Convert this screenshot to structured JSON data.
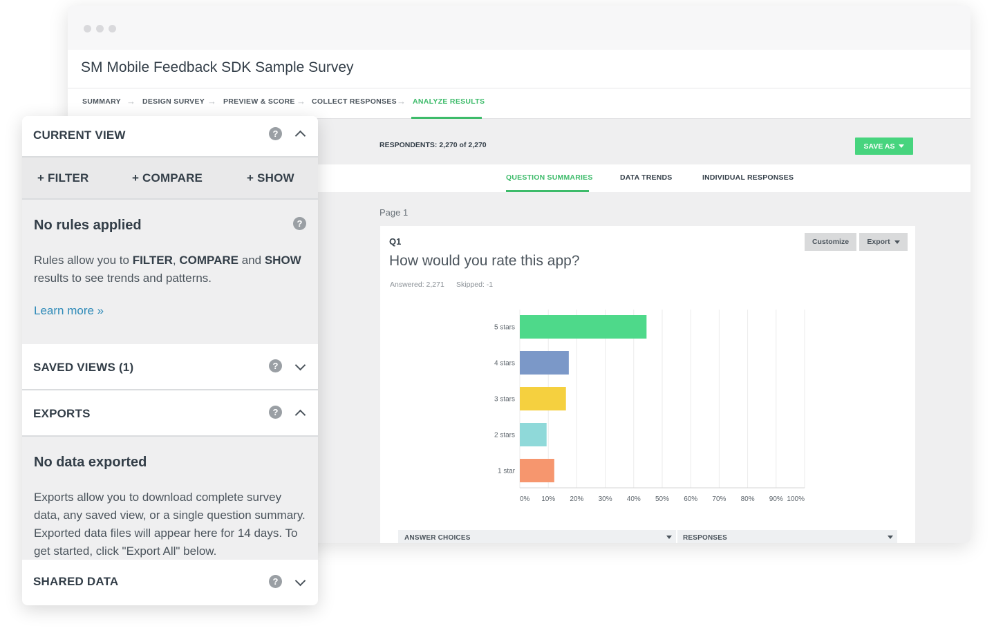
{
  "window": {
    "survey_title": "SM Mobile Feedback SDK Sample Survey",
    "steps": [
      "SUMMARY",
      "DESIGN SURVEY",
      "PREVIEW & SCORE",
      "COLLECT RESPONSES",
      "ANALYZE RESULTS"
    ],
    "active_step": "ANALYZE RESULTS",
    "respondents": "RESPONDENTS: 2,270 of 2,270",
    "save_as": "SAVE AS",
    "tabs": [
      "QUESTION SUMMARIES",
      "DATA TRENDS",
      "INDIVIDUAL RESPONSES"
    ],
    "active_tab": "QUESTION SUMMARIES",
    "page_label": "Page 1"
  },
  "question": {
    "number": "Q1",
    "title": "How would you rate this app?",
    "answered": "Answered: 2,271",
    "skipped": "Skipped: -1",
    "customize_label": "Customize",
    "export_label": "Export",
    "table_headers": [
      "ANSWER CHOICES",
      "RESPONSES"
    ]
  },
  "chart_data": {
    "type": "bar",
    "orientation": "horizontal",
    "categories": [
      "5 stars",
      "4 stars",
      "3 stars",
      "2 stars",
      "1 star"
    ],
    "values": [
      44.5,
      17.2,
      16.2,
      9.4,
      12.1
    ],
    "colors": [
      "#4ed98a",
      "#7b98c8",
      "#f5d03f",
      "#8fd9d9",
      "#f6966e"
    ],
    "xlim": [
      0,
      100
    ],
    "xticks": [
      "0%",
      "10%",
      "20%",
      "30%",
      "40%",
      "50%",
      "60%",
      "70%",
      "80%",
      "90%",
      "100%"
    ],
    "grid": true
  },
  "panel": {
    "current_view": {
      "title": "CURRENT VIEW",
      "actions": [
        "+ FILTER",
        "+ COMPARE",
        "+ SHOW"
      ],
      "no_rules_title": "No rules applied",
      "rules_text_1": "Rules allow you to ",
      "rules_filter": "FILTER",
      "rules_comma": ", ",
      "rules_compare": "COMPARE",
      "rules_and": " and ",
      "rules_show": "SHOW",
      "rules_text_2": "results to see trends and patterns.",
      "learn_more": "Learn more »"
    },
    "saved_views": {
      "title": "SAVED VIEWS (1)"
    },
    "exports": {
      "title": "EXPORTS",
      "no_data_title": "No data exported",
      "text": "Exports allow you to download complete survey data, any saved view, or a single question summary. Exported data files will appear here for 14 days. To get started, click \"Export All\" below."
    },
    "shared_data": {
      "title": "SHARED DATA"
    },
    "help_glyph": "?"
  },
  "colors": {
    "accent": "#3dbb6a",
    "save_button": "#47d47e",
    "link": "#2e8ab8"
  }
}
